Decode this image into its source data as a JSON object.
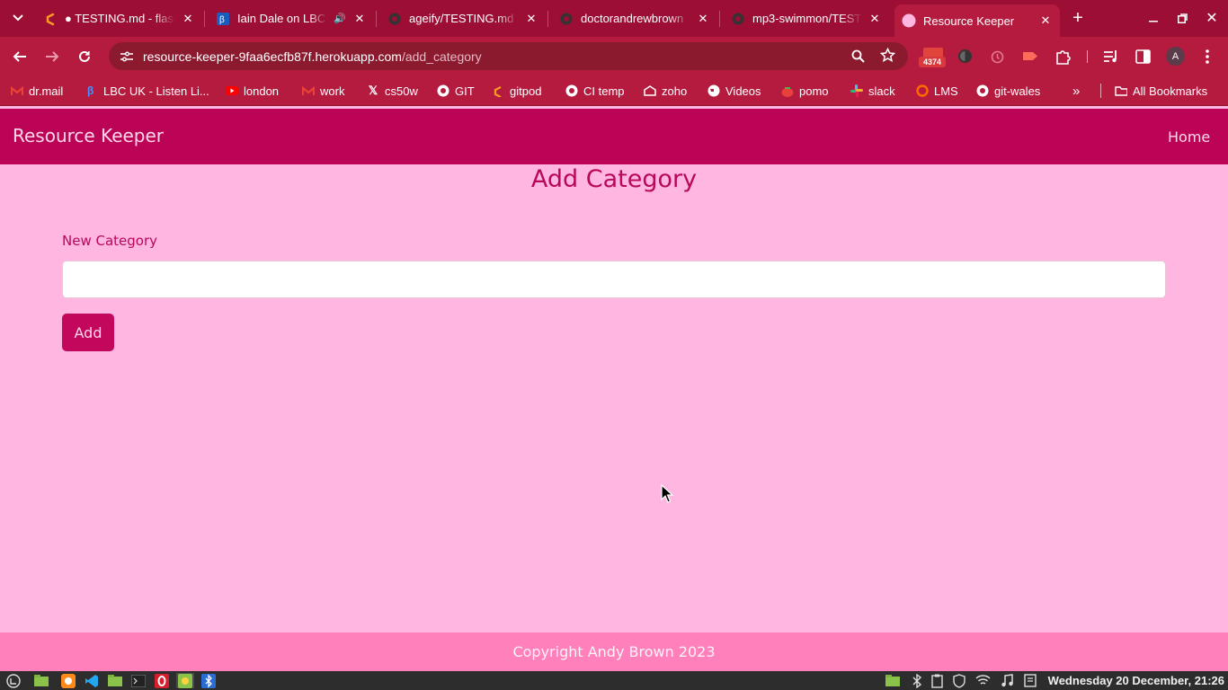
{
  "colors": {
    "tabstrip": "#9c0e33",
    "toolbar": "#b51b3f",
    "appnav": "#bb0455",
    "page_bg": "#ffb6e1",
    "footer": "#ff80ba",
    "button": "#c2075c",
    "heading": "#b8085a"
  },
  "tabs": [
    {
      "title": "● TESTING.md - flask",
      "icon": "gitpod-icon"
    },
    {
      "title": "Iain Dale on LBC",
      "icon": "lbc-icon",
      "audio": "🔊"
    },
    {
      "title": "ageify/TESTING.md at",
      "icon": "github-icon"
    },
    {
      "title": "doctorandrewbrown",
      "icon": "github-icon"
    },
    {
      "title": "mp3-swimmon/TEST",
      "icon": "github-icon"
    },
    {
      "title": "Resource Keeper",
      "icon": "pink-circle-icon"
    }
  ],
  "omnibox": {
    "host": "resource-keeper-9faa6ecfb87f.herokuapp.com",
    "path": "/add_category"
  },
  "extensions": {
    "badge": "4374",
    "profile": "A"
  },
  "bookmarks": [
    {
      "label": "dr.mail",
      "icon": "gmail-icon"
    },
    {
      "label": "LBC UK - Listen Li...",
      "icon": "lbc-icon"
    },
    {
      "label": "london",
      "icon": "youtube-icon"
    },
    {
      "label": "work",
      "icon": "gmail-icon"
    },
    {
      "label": "cs50w",
      "icon": "x-icon"
    },
    {
      "label": "GIT",
      "icon": "github-icon"
    },
    {
      "label": "gitpod",
      "icon": "gitpod-icon"
    },
    {
      "label": "CI temp",
      "icon": "github-icon"
    },
    {
      "label": "zoho",
      "icon": "zoho-icon"
    },
    {
      "label": "Videos",
      "icon": "globe-icon"
    },
    {
      "label": "pomo",
      "icon": "tomato-icon"
    },
    {
      "label": "slack",
      "icon": "slack-icon"
    },
    {
      "label": "LMS",
      "icon": "lms-icon"
    },
    {
      "label": "git-wales",
      "icon": "github-icon"
    }
  ],
  "all_bookmarks": "All Bookmarks",
  "app": {
    "brand": "Resource Keeper",
    "nav_home": "Home",
    "title": "Add Category",
    "field_label": "New Category",
    "field_value": "",
    "submit": "Add",
    "footer": "Copyright Andy Brown 2023"
  },
  "taskbar": {
    "clock": "Wednesday 20 December, 21:26"
  }
}
